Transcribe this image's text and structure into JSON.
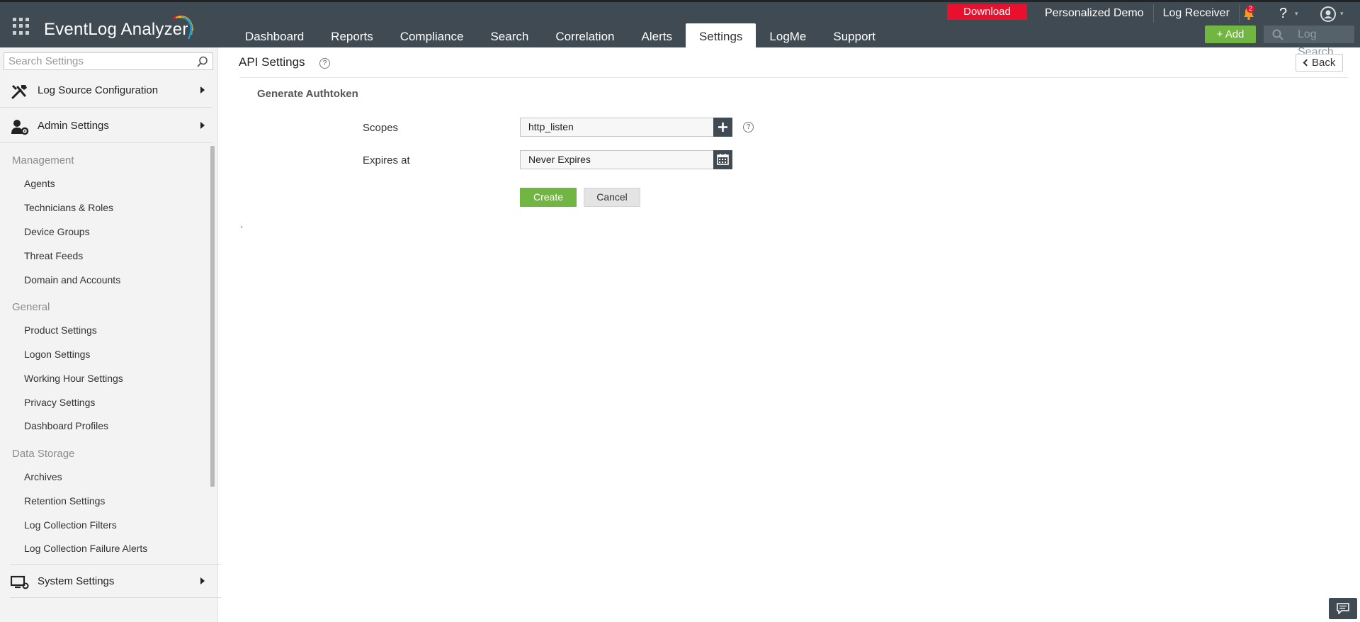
{
  "app": {
    "name": "EventLog Analyzer"
  },
  "nav": {
    "items": [
      "Dashboard",
      "Reports",
      "Compliance",
      "Search",
      "Correlation",
      "Alerts",
      "Settings",
      "LogMe",
      "Support"
    ],
    "active": "Settings"
  },
  "topbar": {
    "download_label": "Download",
    "personalized_demo": "Personalized Demo",
    "log_receiver": "Log Receiver",
    "notification_count": "2",
    "help_label": "?",
    "add_label": "+ Add",
    "log_search_placeholder": "Log Search"
  },
  "sidebar": {
    "search_placeholder": "Search Settings",
    "sections": {
      "log_source": "Log Source Configuration",
      "admin": "Admin Settings",
      "system": "System Settings"
    },
    "groups": {
      "management": {
        "label": "Management",
        "items": [
          "Agents",
          "Technicians & Roles",
          "Device Groups",
          "Threat Feeds",
          "Domain and Accounts"
        ]
      },
      "general": {
        "label": "General",
        "items": [
          "Product Settings",
          "Logon Settings",
          "Working Hour Settings",
          "Privacy Settings",
          "Dashboard Profiles"
        ]
      },
      "data_storage": {
        "label": "Data Storage",
        "items": [
          "Archives",
          "Retention Settings",
          "Log Collection Filters",
          "Log Collection Failure Alerts"
        ]
      }
    }
  },
  "main": {
    "title": "API Settings",
    "back_label": "Back",
    "form_title": "Generate Authtoken",
    "scopes_label": "Scopes",
    "scopes_value": "http_listen",
    "expires_label": "Expires at",
    "expires_value": "Never Expires",
    "create_label": "Create",
    "cancel_label": "Cancel",
    "stray_mark": "`"
  },
  "colors": {
    "topbar_bg": "#3f4a52",
    "accent_green": "#71b543",
    "download_red": "#e8102d"
  },
  "icons": [
    "apps-grid-icon",
    "logo-arc-icon",
    "bell-icon",
    "help-icon",
    "user-icon",
    "search-icon",
    "tools-icon",
    "admin-user-gear-icon",
    "monitor-gear-icon",
    "plus-icon",
    "calendar-icon",
    "chat-icon"
  ]
}
